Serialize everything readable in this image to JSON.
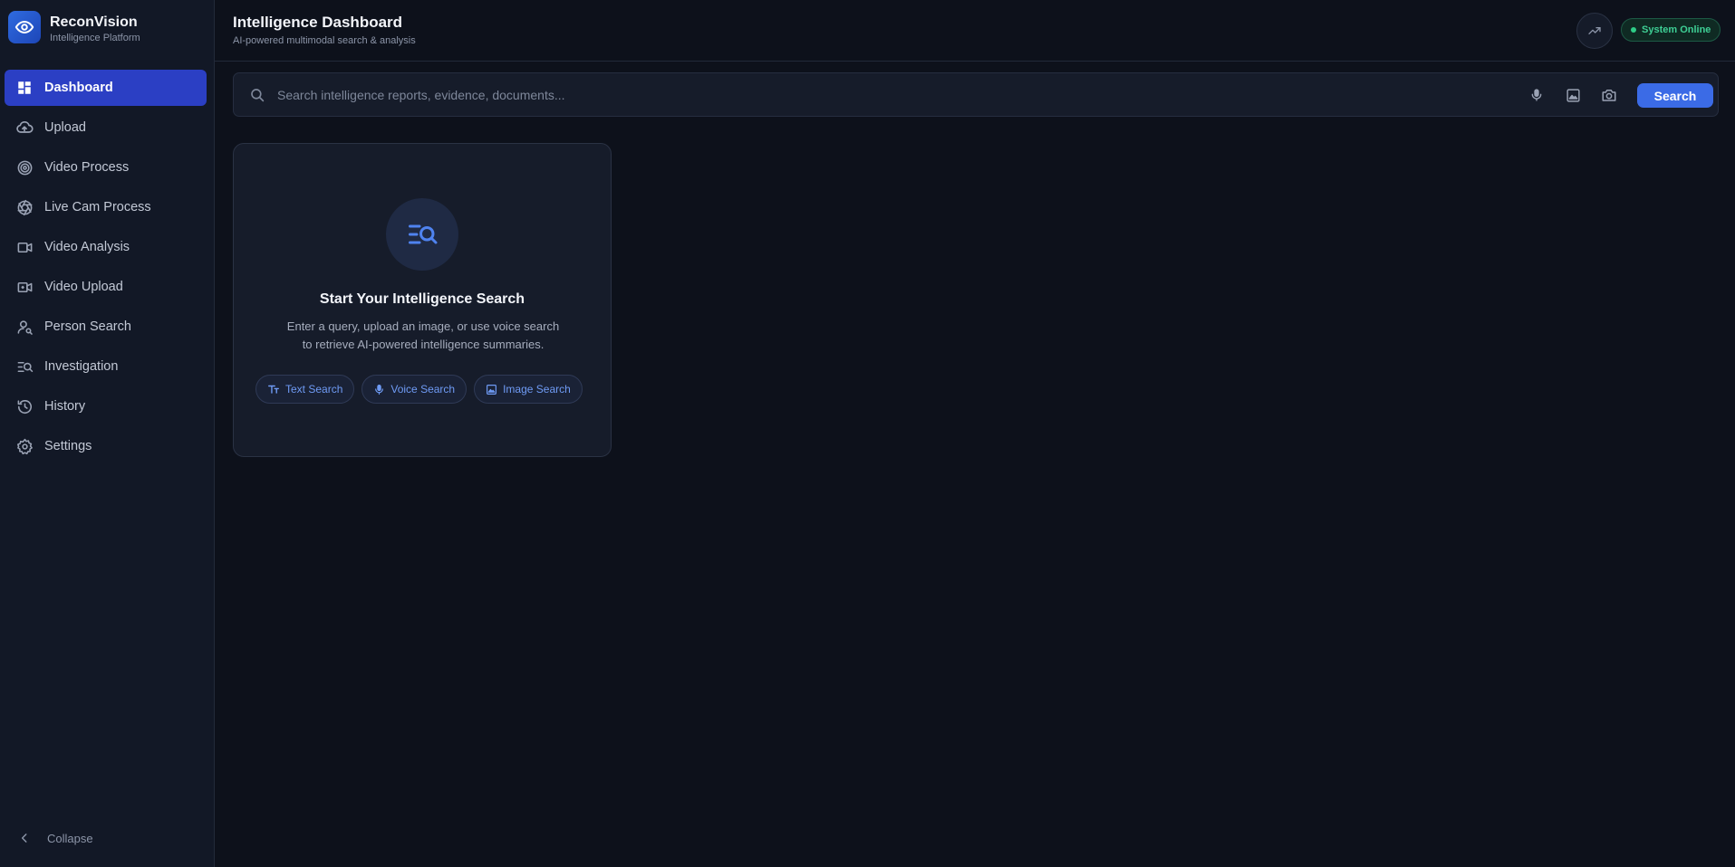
{
  "brand": {
    "name": "ReconVision",
    "subtitle": "Intelligence Platform",
    "icon": "eye-icon"
  },
  "sidebar": {
    "items": [
      {
        "label": "Dashboard",
        "icon": "dashboard-icon",
        "active": true
      },
      {
        "label": "Upload",
        "icon": "cloud-upload-icon"
      },
      {
        "label": "Video Process",
        "icon": "target-icon"
      },
      {
        "label": "Live Cam Process",
        "icon": "aperture-icon"
      },
      {
        "label": "Video Analysis",
        "icon": "video-camera-icon"
      },
      {
        "label": "Video Upload",
        "icon": "video-upload-icon"
      },
      {
        "label": "Person Search",
        "icon": "person-search-icon"
      },
      {
        "label": "Investigation",
        "icon": "list-search-icon"
      },
      {
        "label": "History",
        "icon": "history-icon"
      },
      {
        "label": "Settings",
        "icon": "gear-icon"
      }
    ],
    "collapse_label": "Collapse"
  },
  "header": {
    "title": "Intelligence Dashboard",
    "subtitle": "AI-powered multimodal search & analysis",
    "status": "System Online"
  },
  "search": {
    "placeholder": "Search intelligence reports, evidence, documents...",
    "value": "",
    "button_label": "Search"
  },
  "card": {
    "title": "Start Your Intelligence Search",
    "desc_line1": "Enter a query, upload an image, or use voice search",
    "desc_line2": "to retrieve AI-powered intelligence summaries.",
    "chips": [
      {
        "label": "Text Search",
        "icon": "text-icon"
      },
      {
        "label": "Voice Search",
        "icon": "mic-icon"
      },
      {
        "label": "Image Search",
        "icon": "image-icon"
      }
    ]
  },
  "colors": {
    "accent": "#2b3fc4",
    "button": "#3b6be6",
    "status": "#3ecf95",
    "background": "#0d111b"
  }
}
